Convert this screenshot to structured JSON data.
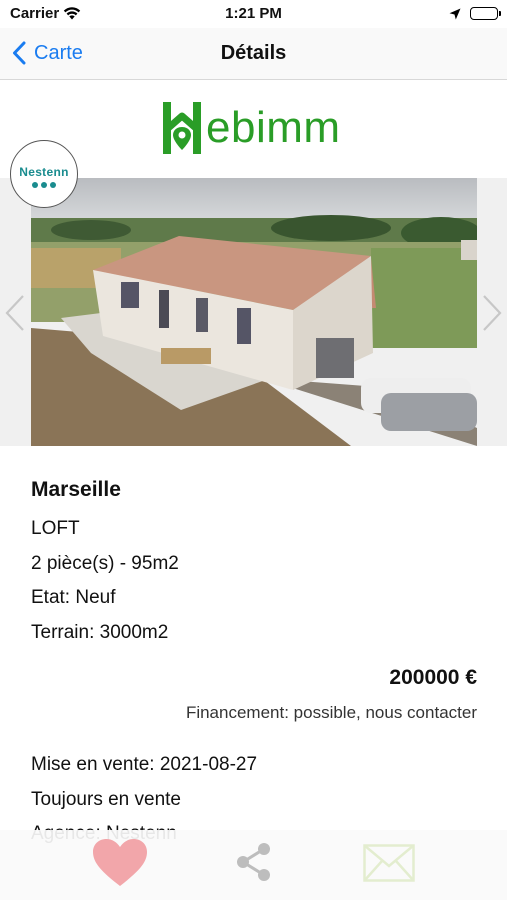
{
  "status_bar": {
    "carrier": "Carrier",
    "time": "1:21 PM"
  },
  "nav": {
    "back_label": "Carte",
    "title": "Détails"
  },
  "logo": {
    "text": "ebimm",
    "color": "#2a9d27"
  },
  "agency_badge": {
    "name": "Nestenn"
  },
  "listing": {
    "city": "Marseille",
    "type": "LOFT",
    "rooms_area": "2 pièce(s) - 95m2",
    "state": "Etat: Neuf",
    "land": "Terrain: 3000m2",
    "price": "200000 €",
    "financing": "Financement: possible, nous contacter",
    "listed_date": "Mise en vente: 2021-08-27",
    "availability": "Toujours en vente",
    "agency": "Agence: Nestenn"
  },
  "colors": {
    "accent": "#1a7cf0",
    "heart": "#f2a6aa",
    "share": "#bdbdbd",
    "mail": "#e3edcf",
    "brand_green": "#2a9d27",
    "agency_teal": "#1a8c8f"
  },
  "icons": [
    "wifi-icon",
    "location-arrow-icon",
    "battery-icon",
    "chevron-left-icon",
    "chevron-right-icon",
    "heart-icon",
    "share-icon",
    "mail-icon"
  ]
}
